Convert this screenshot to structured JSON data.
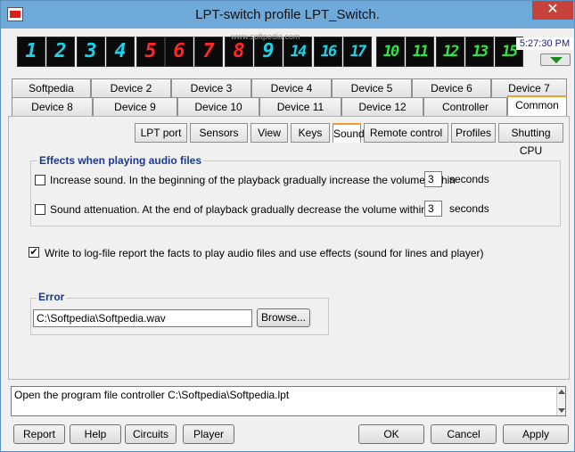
{
  "window": {
    "title": "LPT-switch profile LPT_Switch.",
    "close_glyph": "✕"
  },
  "leds": [
    {
      "char": "1",
      "color": "cyan"
    },
    {
      "char": "2",
      "color": "cyan"
    },
    {
      "char": "3",
      "color": "cyan"
    },
    {
      "char": "4",
      "color": "cyan"
    },
    {
      "char": "5",
      "color": "red"
    },
    {
      "char": "6",
      "color": "red"
    },
    {
      "char": "7",
      "color": "red"
    },
    {
      "char": "8",
      "color": "red"
    },
    {
      "char": "9",
      "color": "cyan"
    },
    {
      "char": "14",
      "color": "cyan"
    },
    {
      "char": "16",
      "color": "cyan"
    },
    {
      "char": "17",
      "color": "cyan"
    },
    {
      "char": "10",
      "color": "green"
    },
    {
      "char": "11",
      "color": "green"
    },
    {
      "char": "12",
      "color": "green"
    },
    {
      "char": "13",
      "color": "green"
    },
    {
      "char": "15",
      "color": "green"
    }
  ],
  "clock": {
    "time": "5:27:30 PM"
  },
  "watermark": "www.softpedia.com",
  "tabs_row1": [
    "Softpedia",
    "Device 2",
    "Device 3",
    "Device 4",
    "Device 5",
    "Device 6",
    "Device 7"
  ],
  "tabs_row2": [
    "Device 8",
    "Device 9",
    "Device 10",
    "Device 11",
    "Device 12",
    "Controller",
    "Common"
  ],
  "active_tab": "Common",
  "subtabs": [
    "LPT port",
    "Sensors",
    "View",
    "Keys",
    "Sound",
    "Remote control",
    "Profiles",
    "Shutting CPU"
  ],
  "active_subtab": "Sound",
  "effects": {
    "legend": "Effects when playing audio files",
    "increase_label": "Increase sound. In the beginning of the playback gradually increase the volume within",
    "increase_value": "3",
    "increase_unit": "seconds",
    "increase_checked": false,
    "attenuation_label": "Sound attenuation. At the end of playback gradually decrease the volume within",
    "attenuation_value": "3",
    "attenuation_unit": "seconds",
    "attenuation_checked": false
  },
  "logfile": {
    "label": "Write to log-file report the facts to play audio files and use effects (sound for lines and player)",
    "checked": true,
    "check_glyph": "✔"
  },
  "error": {
    "legend": "Error",
    "file_value": "C:\\Softpedia\\Softpedia.wav",
    "browse_label": "Browse..."
  },
  "log": {
    "text": "Open the program file controller C:\\Softpedia\\Softpedia.lpt"
  },
  "buttons": {
    "report": "Report",
    "help": "Help",
    "circuits": "Circuits",
    "player": "Player",
    "ok": "OK",
    "cancel": "Cancel",
    "apply": "Apply"
  }
}
